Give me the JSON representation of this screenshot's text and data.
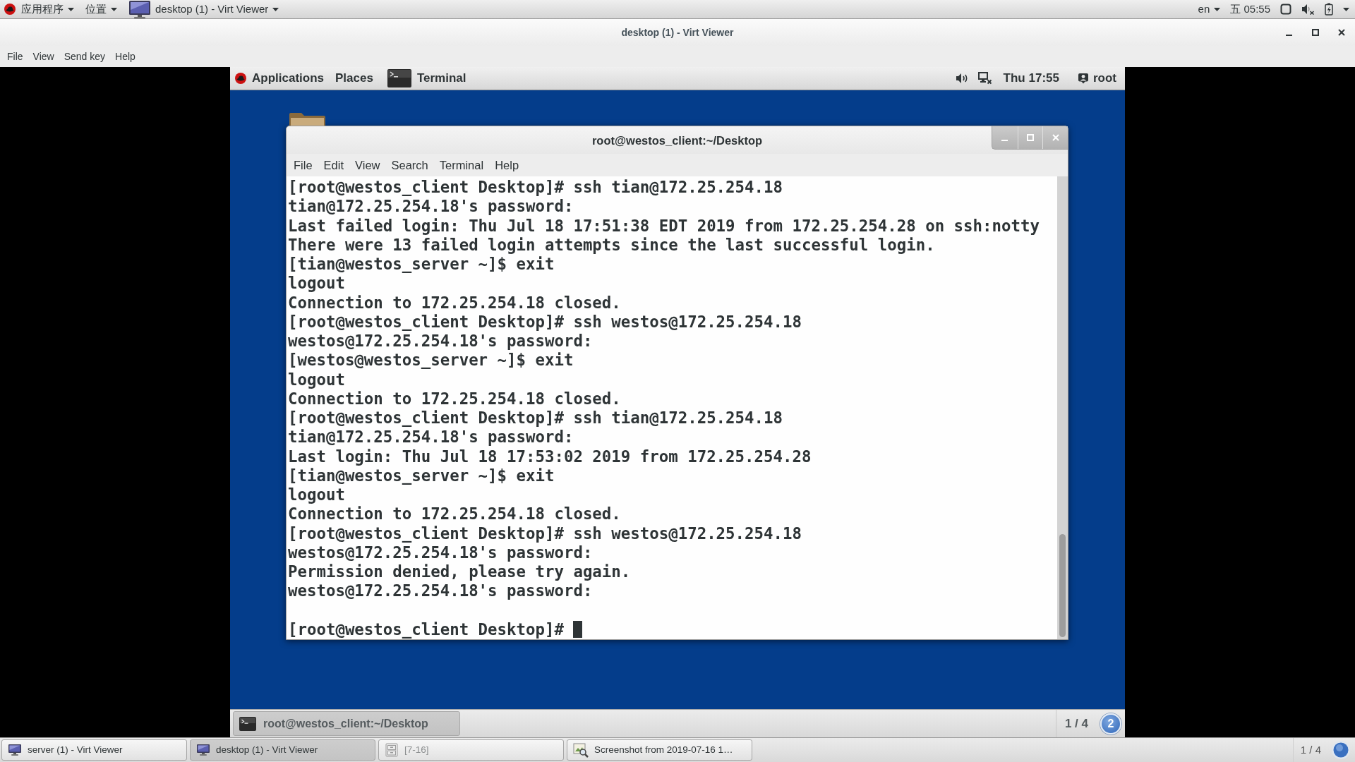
{
  "host_top_bar": {
    "menus": [
      "应用程序",
      "位置"
    ],
    "window_menu": "desktop (1) - Virt Viewer",
    "input_source": "en",
    "clock": "五 05:55"
  },
  "window": {
    "title": "desktop (1) - Virt Viewer",
    "menu": [
      "File",
      "View",
      "Send key",
      "Help"
    ]
  },
  "guest_top_panel": {
    "menus": [
      "Applications",
      "Places"
    ],
    "app_menu": "Terminal",
    "clock": "Thu 17:55",
    "user": "root"
  },
  "terminal": {
    "title": "root@westos_client:~/Desktop",
    "menu": [
      "File",
      "Edit",
      "View",
      "Search",
      "Terminal",
      "Help"
    ],
    "lines": [
      {
        "kind": "text",
        "text": "[root@westos_client Desktop]# ssh tian@172.25.254.18"
      },
      {
        "kind": "text",
        "text": "tian@172.25.254.18's password:"
      },
      {
        "kind": "text",
        "text": "Last failed login: Thu Jul 18 17:51:38 EDT 2019 from 172.25.254.28 on ssh:notty"
      },
      {
        "kind": "text",
        "text": "There were 13 failed login attempts since the last successful login."
      },
      {
        "kind": "text",
        "text": "[tian@westos_server ~]$ exit"
      },
      {
        "kind": "text",
        "text": "logout"
      },
      {
        "kind": "text",
        "text": "Connection to 172.25.254.18 closed."
      },
      {
        "kind": "text",
        "text": "[root@westos_client Desktop]# ssh westos@172.25.254.18"
      },
      {
        "kind": "text",
        "text": "westos@172.25.254.18's password:"
      },
      {
        "kind": "text",
        "text": "[westos@westos_server ~]$ exit"
      },
      {
        "kind": "text",
        "text": "logout"
      },
      {
        "kind": "text",
        "text": "Connection to 172.25.254.18 closed."
      },
      {
        "kind": "text",
        "text": "[root@westos_client Desktop]# ssh tian@172.25.254.18"
      },
      {
        "kind": "text",
        "text": "tian@172.25.254.18's password:"
      },
      {
        "kind": "text",
        "text": "Last login: Thu Jul 18 17:53:02 2019 from 172.25.254.28"
      },
      {
        "kind": "text",
        "text": "[tian@westos_server ~]$ exit"
      },
      {
        "kind": "text",
        "text": "logout"
      },
      {
        "kind": "text",
        "text": "Connection to 172.25.254.18 closed."
      },
      {
        "kind": "text",
        "text": "[root@westos_client Desktop]# ssh westos@172.25.254.18"
      },
      {
        "kind": "text",
        "text": "westos@172.25.254.18's password:"
      },
      {
        "kind": "text",
        "text": "Permission denied, please try again."
      },
      {
        "kind": "text",
        "text": "westos@172.25.254.18's password:"
      },
      {
        "kind": "blank"
      },
      {
        "kind": "prompt",
        "text": "[root@westos_client Desktop]#",
        "cursor": true
      }
    ]
  },
  "guest_bottom_panel": {
    "tasks": [
      {
        "label": "root@westos_client:~/Desktop",
        "selected": true
      }
    ],
    "workspace": "1 / 4",
    "notification_count": "2"
  },
  "taskbar": {
    "tasks": [
      {
        "kind": "viewer",
        "label": "server (1) - Virt Viewer",
        "selected": false,
        "minimized": false
      },
      {
        "kind": "viewer",
        "label": "desktop (1) - Virt Viewer",
        "selected": true,
        "minimized": false
      },
      {
        "kind": "files",
        "label": "[7-16]",
        "selected": false,
        "minimized": true
      },
      {
        "kind": "screenshot",
        "label": "Screenshot from 2019-07-16 1…",
        "selected": false,
        "minimized": false
      }
    ],
    "workspace": "1 / 4"
  }
}
